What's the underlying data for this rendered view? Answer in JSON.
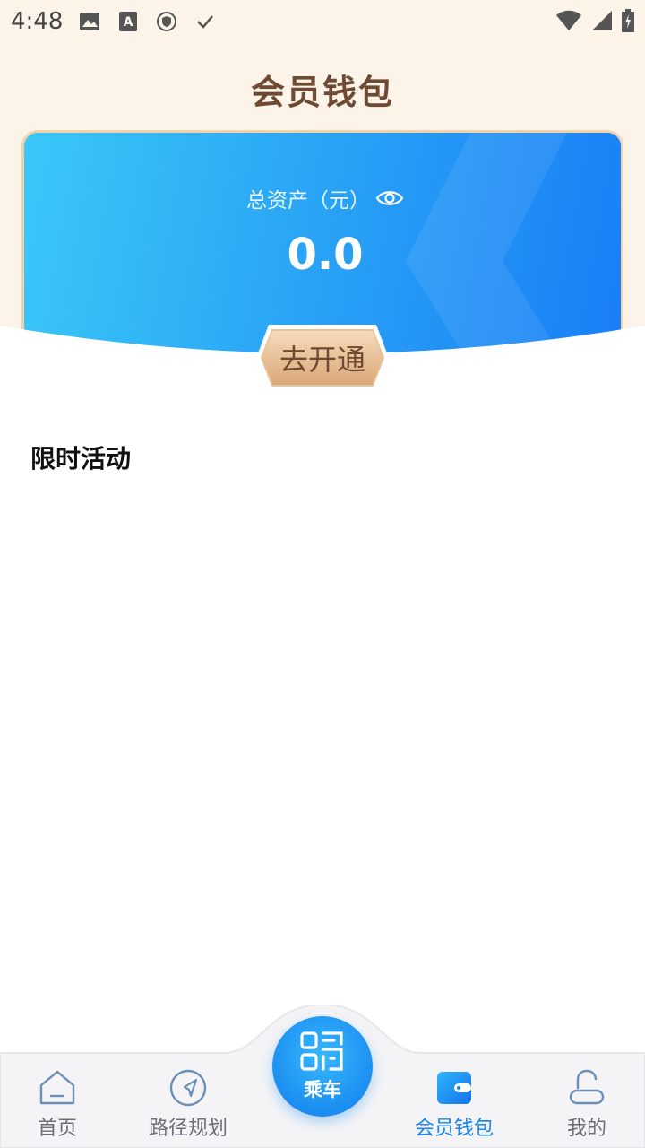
{
  "status_bar": {
    "time": "4:48"
  },
  "header": {
    "title": "会员钱包"
  },
  "wallet_card": {
    "asset_label": "总资产（元）",
    "asset_value": "0.0",
    "open_button_label": "去开通"
  },
  "section": {
    "title": "限时活动"
  },
  "tabbar": {
    "items": [
      {
        "label": "首页",
        "icon": "home-icon",
        "active": false
      },
      {
        "label": "路径规划",
        "icon": "navigation-icon",
        "active": false
      },
      {
        "label": "乘车",
        "icon": "qr-code-icon",
        "active": false
      },
      {
        "label": "会员钱包",
        "icon": "wallet-icon",
        "active": true
      },
      {
        "label": "我的",
        "icon": "profile-icon",
        "active": false
      }
    ]
  },
  "colors": {
    "accent_blue": "#1a86ee",
    "title_brown": "#6e4a33",
    "header_bg": "#fcf4e8"
  }
}
